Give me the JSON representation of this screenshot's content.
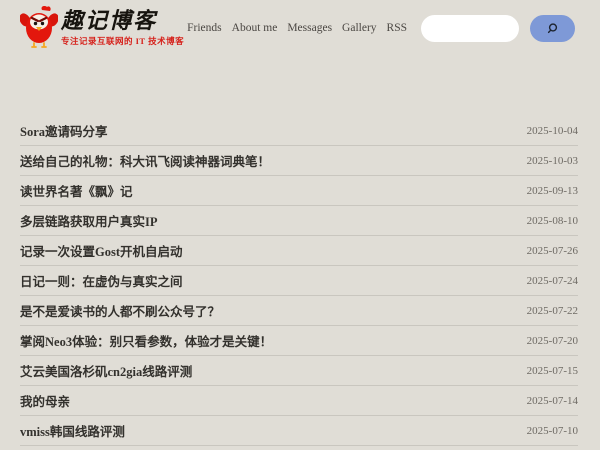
{
  "site": {
    "title": "趣记博客",
    "tagline": "专注记录互联网的 IT 技术博客"
  },
  "nav": {
    "items": [
      {
        "label": "Friends"
      },
      {
        "label": "About me"
      },
      {
        "label": "Messages"
      },
      {
        "label": "Gallery"
      },
      {
        "label": "RSS"
      }
    ]
  },
  "search": {
    "value": "",
    "placeholder": "",
    "button_icon": "magnifier-icon"
  },
  "posts": [
    {
      "title": "Sora邀请码分享",
      "date": "2025-10-04"
    },
    {
      "title": "送给自己的礼物：科大讯飞阅读神器词典笔！",
      "date": "2025-10-03"
    },
    {
      "title": "读世界名著《飘》记",
      "date": "2025-09-13"
    },
    {
      "title": "多层链路获取用户真实IP",
      "date": "2025-08-10"
    },
    {
      "title": "记录一次设置Gost开机自启动",
      "date": "2025-07-26"
    },
    {
      "title": "日记一则：在虚伪与真实之间",
      "date": "2025-07-24"
    },
    {
      "title": "是不是爱读书的人都不刷公众号了？",
      "date": "2025-07-22"
    },
    {
      "title": "掌阅Neo3体验：别只看参数，体验才是关键！",
      "date": "2025-07-20"
    },
    {
      "title": "艾云美国洛杉矶cn2gia线路评测",
      "date": "2025-07-15"
    },
    {
      "title": "我的母亲",
      "date": "2025-07-14"
    },
    {
      "title": "vmiss韩国线路评测",
      "date": "2025-07-10"
    }
  ],
  "colors": {
    "background": "#e0ddd6",
    "accent_red": "#d6201a",
    "search_button": "#7e99d7",
    "post_title_text": "#33312d",
    "date_text": "#6e6a64",
    "divider": "#c9c6bf"
  }
}
